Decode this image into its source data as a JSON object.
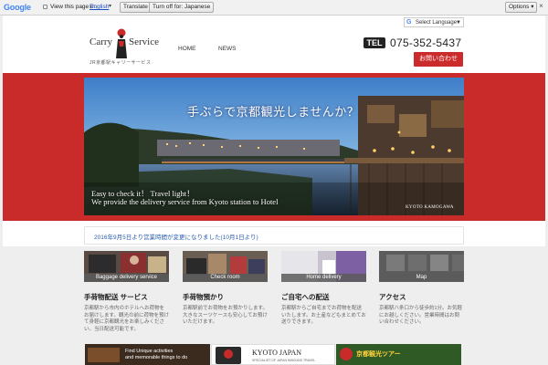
{
  "translate_bar": {
    "google": "Google",
    "view_text": "View this page in:",
    "language": "English",
    "translate_button": "Translate",
    "turn_off_button": "Turn off for: Japanese",
    "options_button": "Options ▾",
    "close": "×"
  },
  "header": {
    "select_language": "Select Language",
    "logo_word1": "Carry",
    "logo_word2": "Service",
    "logo_sub": "JR京都駅キャリーサービス",
    "nav": [
      "HOME",
      "NEWS"
    ],
    "tel_label": "TEL",
    "tel_number": "075-352-5437",
    "contact_button": "お問い合わせ"
  },
  "hero": {
    "title": "手ぶらで京都観光しませんか？",
    "caption_line1": "Easy to check it！ Travel light！",
    "caption_line2": "We provide the delivery service from Kyoto station to Hotel",
    "credit": "KYOTO KAMOGAWA"
  },
  "news": {
    "text": "2016年9月5日より営業時間が変更になりました(10月1日より)"
  },
  "cards": [
    {
      "label": "Baggage delivery service",
      "title": "手荷物配送 サービス",
      "desc": "京都駅から市内のホテルへお荷物をお届けします。観光の前に荷物を預けて身軽に京都観光をお楽しみください。当日配送可能です。"
    },
    {
      "label": "Check room",
      "title": "手荷物預かり",
      "desc": "京都駅前でお荷物をお預かりします。大きなスーツケースも安心してお預けいただけます。"
    },
    {
      "label": "Home delivery",
      "title": "ご自宅への配送",
      "desc": "京都駅からご自宅までお荷物を配送いたします。お土産などもまとめてお送りできます。"
    },
    {
      "label": "Map",
      "title": "アクセス",
      "desc": "京都駅八条口から徒歩約1分。お気軽にお越しください。営業時間はお問い合わせください。"
    }
  ],
  "banners": [
    {
      "text1": "Find Unique activities",
      "text2": "and memorable things to do"
    },
    {
      "text1": "KYOTO JAPAN",
      "text2": "SPECIALIST OF JAPAN INBOUND TRAVEL"
    },
    {
      "text1": "京都観光ツアー",
      "text2": ""
    }
  ],
  "colors": {
    "brand_red": "#c92a2a",
    "link_blue": "#2a5db0"
  }
}
